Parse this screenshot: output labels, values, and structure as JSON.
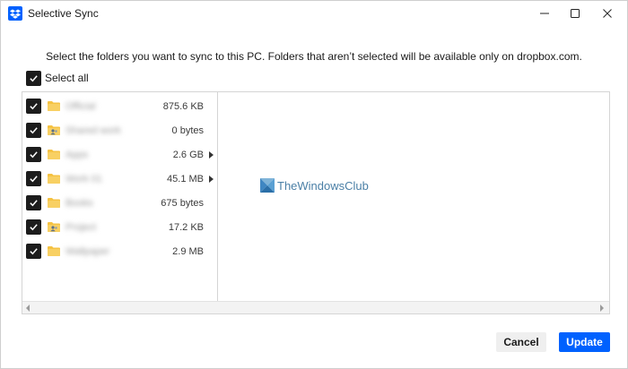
{
  "window": {
    "title": "Selective Sync",
    "app_icon": "dropbox-icon"
  },
  "colors": {
    "accent": "#0061fe",
    "checkbox": "#1c1c1c",
    "folder": "#f5c242"
  },
  "instructions": "Select the folders you want to sync to this PC. Folders that aren’t selected will be available only on dropbox.com.",
  "select_all": {
    "label": "Select all",
    "checked": true
  },
  "folders": [
    {
      "name": "Official",
      "size": "875.6 KB",
      "icon": "folder-icon",
      "has_children": false,
      "checked": true
    },
    {
      "name": "Shared work",
      "size": "0 bytes",
      "icon": "shared-folder-icon",
      "has_children": false,
      "checked": true
    },
    {
      "name": "Apps",
      "size": "2.6 GB",
      "icon": "folder-icon",
      "has_children": true,
      "checked": true
    },
    {
      "name": "Work 01",
      "size": "45.1 MB",
      "icon": "folder-icon",
      "has_children": true,
      "checked": true
    },
    {
      "name": "Books",
      "size": "675 bytes",
      "icon": "folder-icon",
      "has_children": false,
      "checked": true
    },
    {
      "name": "Project",
      "size": "17.2 KB",
      "icon": "shared-folder-icon",
      "has_children": false,
      "checked": true
    },
    {
      "name": "Wallpaper",
      "size": "2.9 MB",
      "icon": "folder-icon",
      "has_children": false,
      "checked": true
    }
  ],
  "watermark": {
    "text": "TheWindowsClub"
  },
  "buttons": {
    "cancel": "Cancel",
    "update": "Update"
  }
}
